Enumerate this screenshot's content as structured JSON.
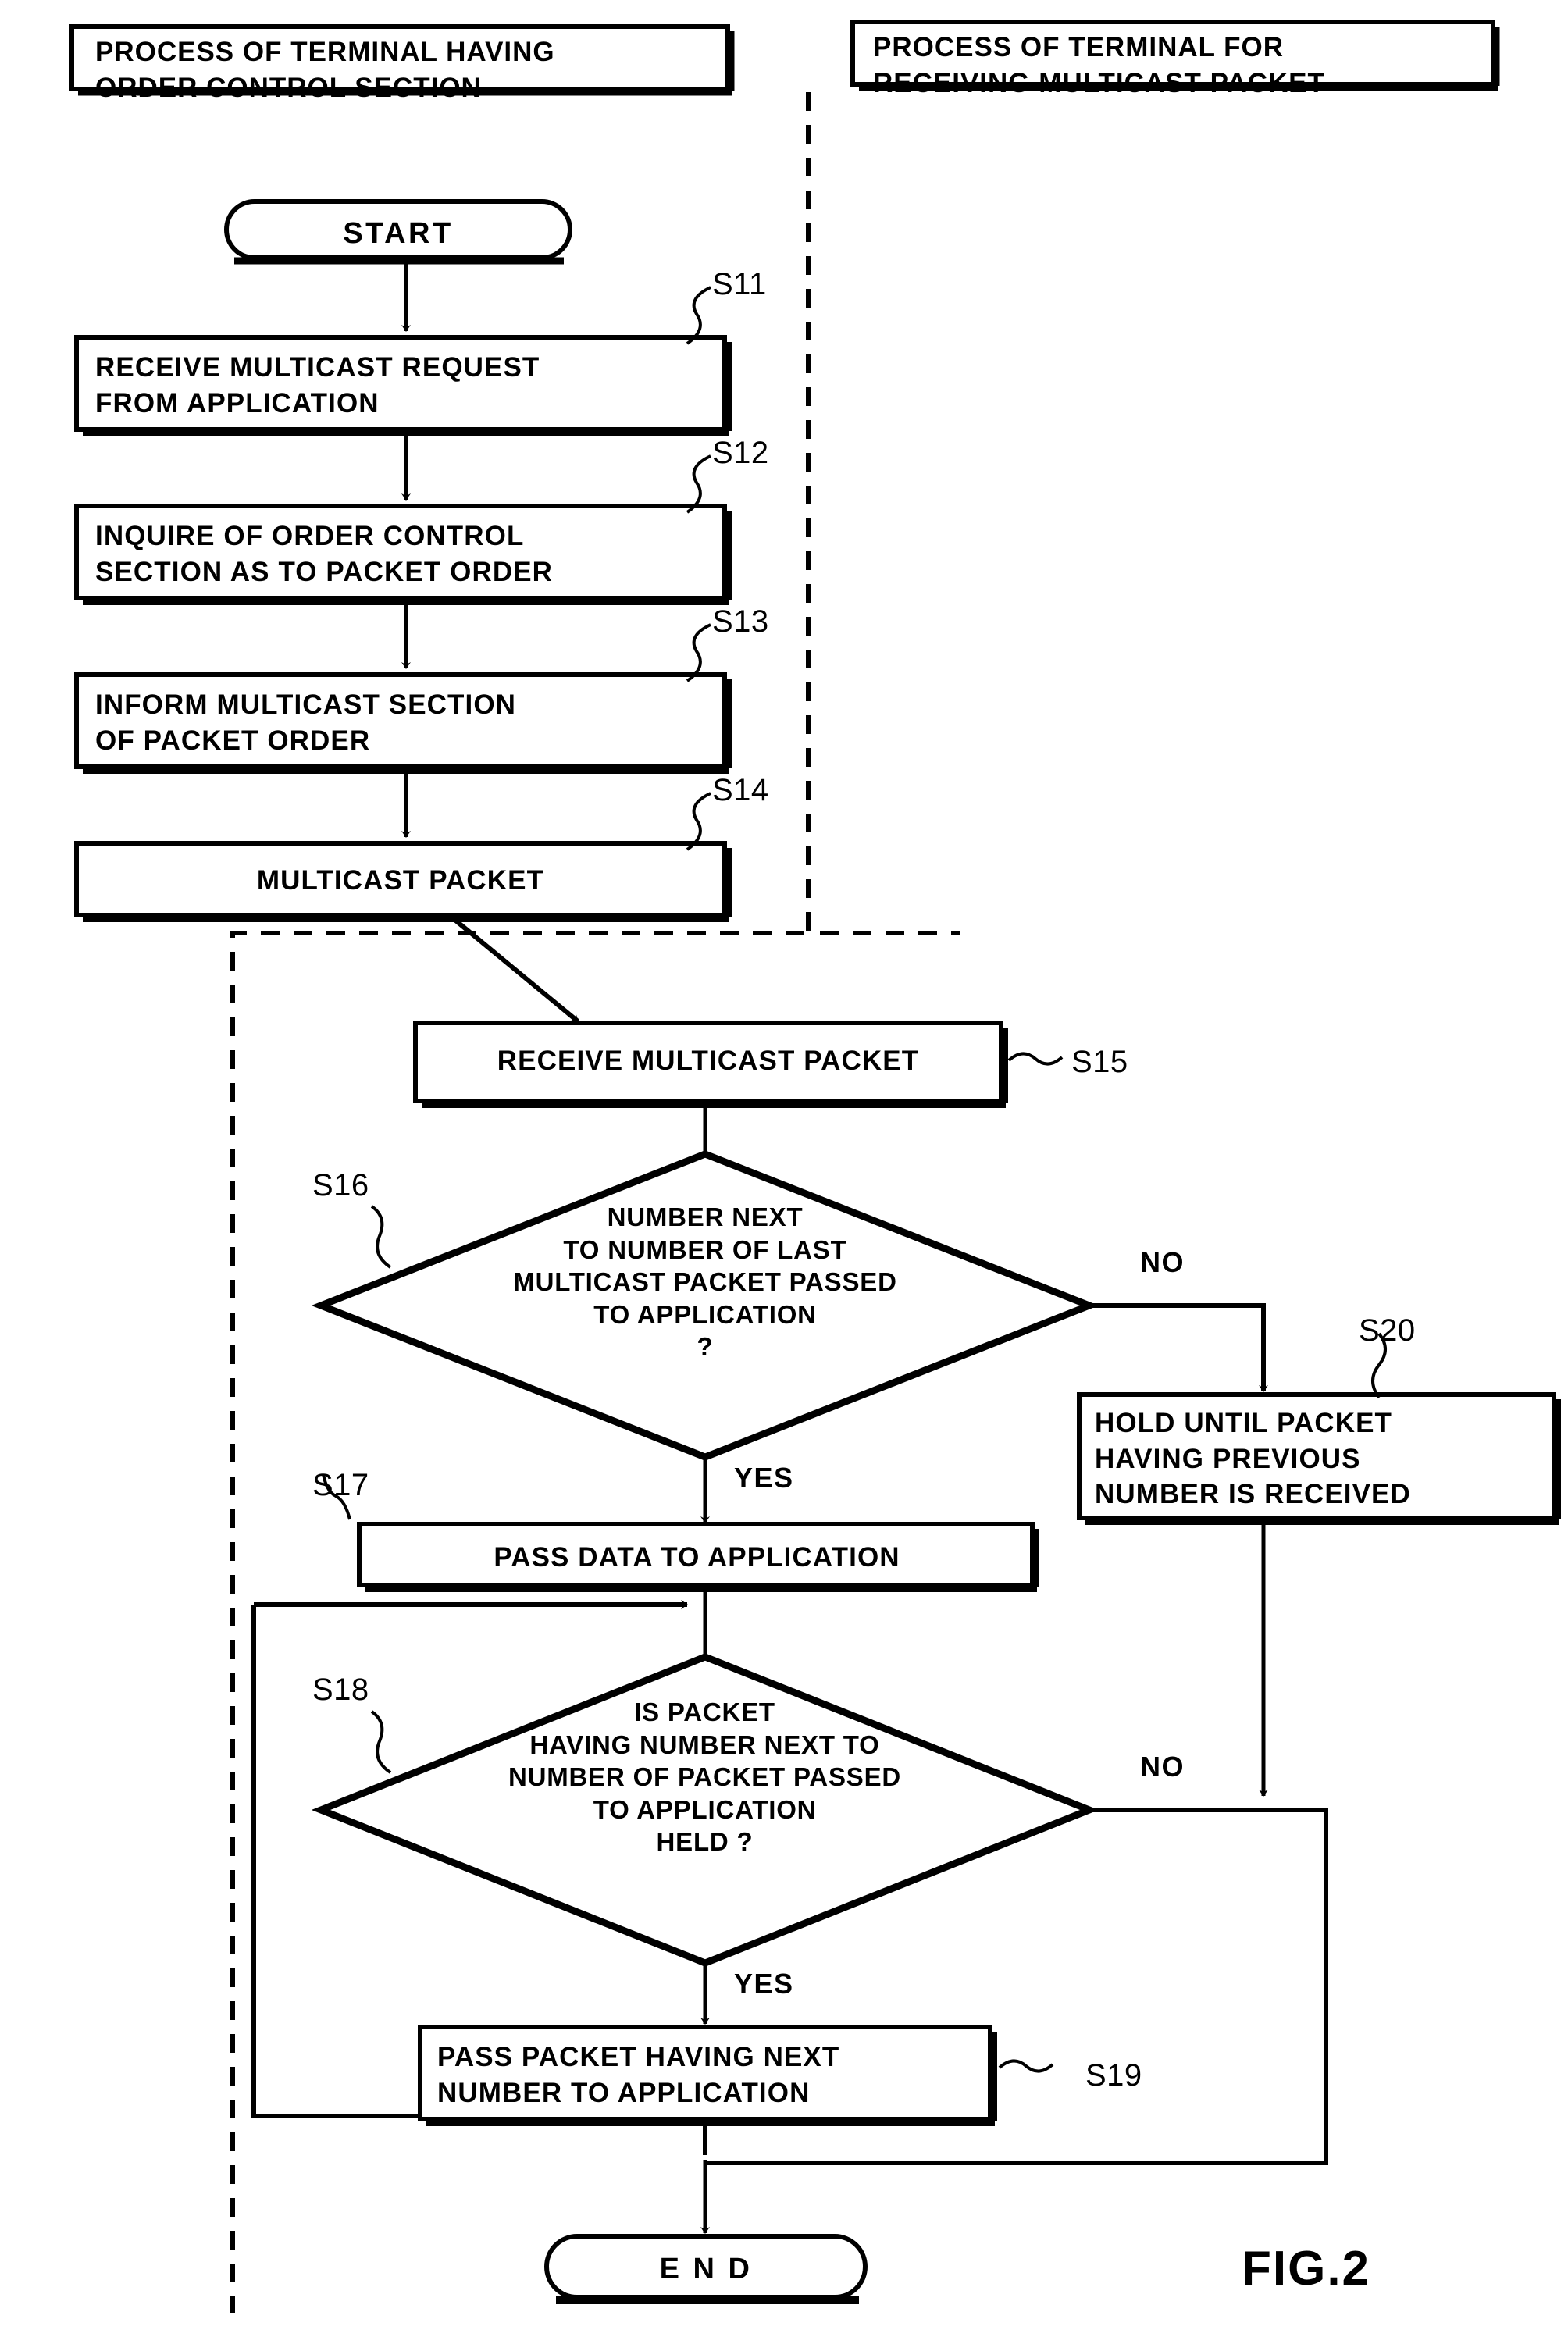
{
  "figure": {
    "label": "FIG.2"
  },
  "lanes": {
    "left_header": "PROCESS OF TERMINAL HAVING\nORDER CONTROL SECTION",
    "right_header": "PROCESS OF TERMINAL FOR\nRECEIVING MULTICAST PACKET"
  },
  "nodes": {
    "start": {
      "label": "START",
      "shape": "terminator"
    },
    "s11": {
      "label": "RECEIVE MULTICAST REQUEST\nFROM APPLICATION",
      "ref": "S11",
      "shape": "process"
    },
    "s12": {
      "label": "INQUIRE OF ORDER CONTROL\nSECTION AS TO PACKET ORDER",
      "ref": "S12",
      "shape": "process"
    },
    "s13": {
      "label": "INFORM MULTICAST SECTION\nOF PACKET ORDER",
      "ref": "S13",
      "shape": "process"
    },
    "s14": {
      "label": "MULTICAST PACKET",
      "ref": "S14",
      "shape": "process"
    },
    "s15": {
      "label": "RECEIVE MULTICAST PACKET",
      "ref": "S15",
      "shape": "process"
    },
    "s16": {
      "label": "NUMBER NEXT\nTO NUMBER OF LAST\nMULTICAST PACKET PASSED\nTO APPLICATION\n?",
      "ref": "S16",
      "shape": "decision"
    },
    "s17": {
      "label": "PASS DATA TO APPLICATION",
      "ref": "S17",
      "shape": "process"
    },
    "s18": {
      "label": "IS PACKET\nHAVING NUMBER NEXT TO\nNUMBER OF PACKET PASSED\nTO APPLICATION\nHELD ?",
      "ref": "S18",
      "shape": "decision"
    },
    "s19": {
      "label": "PASS PACKET HAVING NEXT\nNUMBER TO APPLICATION",
      "ref": "S19",
      "shape": "process"
    },
    "s20": {
      "label": "HOLD UNTIL PACKET\nHAVING PREVIOUS\nNUMBER IS RECEIVED",
      "ref": "S20",
      "shape": "process"
    },
    "end": {
      "label": "E N D",
      "shape": "terminator"
    }
  },
  "edge_labels": {
    "s16_no": "NO",
    "s16_yes": "YES",
    "s18_no": "NO",
    "s18_yes": "YES"
  },
  "colors": {
    "stroke": "#000000",
    "background": "#ffffff"
  }
}
